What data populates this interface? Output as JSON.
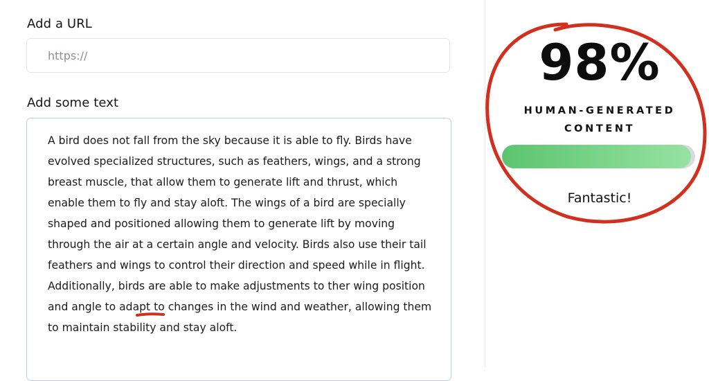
{
  "form": {
    "url_label": "Add a URL",
    "url_placeholder": "https://",
    "text_label": "Add some text",
    "text_value": "A bird does not fall from the sky because it is able to fly. Birds have evolved specialized structures, such as feathers, wings, and a strong breast muscle, that allow them to generate lift and thrust, which enable them to fly and stay aloft. The wings of a bird are specially shaped and positioned allowing them to generate lift by moving through the air at a certain angle and velocity. Birds also use their tail feathers and wings to control their direction and speed while in flight. Additionally, birds are able to make adjustments to ther wing position and angle to adapt to changes in the wind and weather, allowing them to maintain stability and stay aloft."
  },
  "result": {
    "score": "98%",
    "label": "HUMAN-GENERATED CONTENT",
    "progress_fraction": 0.98,
    "verdict": "Fantastic!"
  },
  "colors": {
    "annotation": "#d2301f",
    "bar_start": "#5cc46e",
    "bar_end": "#97e2a2",
    "input_focus_border": "#b9cdf4"
  }
}
